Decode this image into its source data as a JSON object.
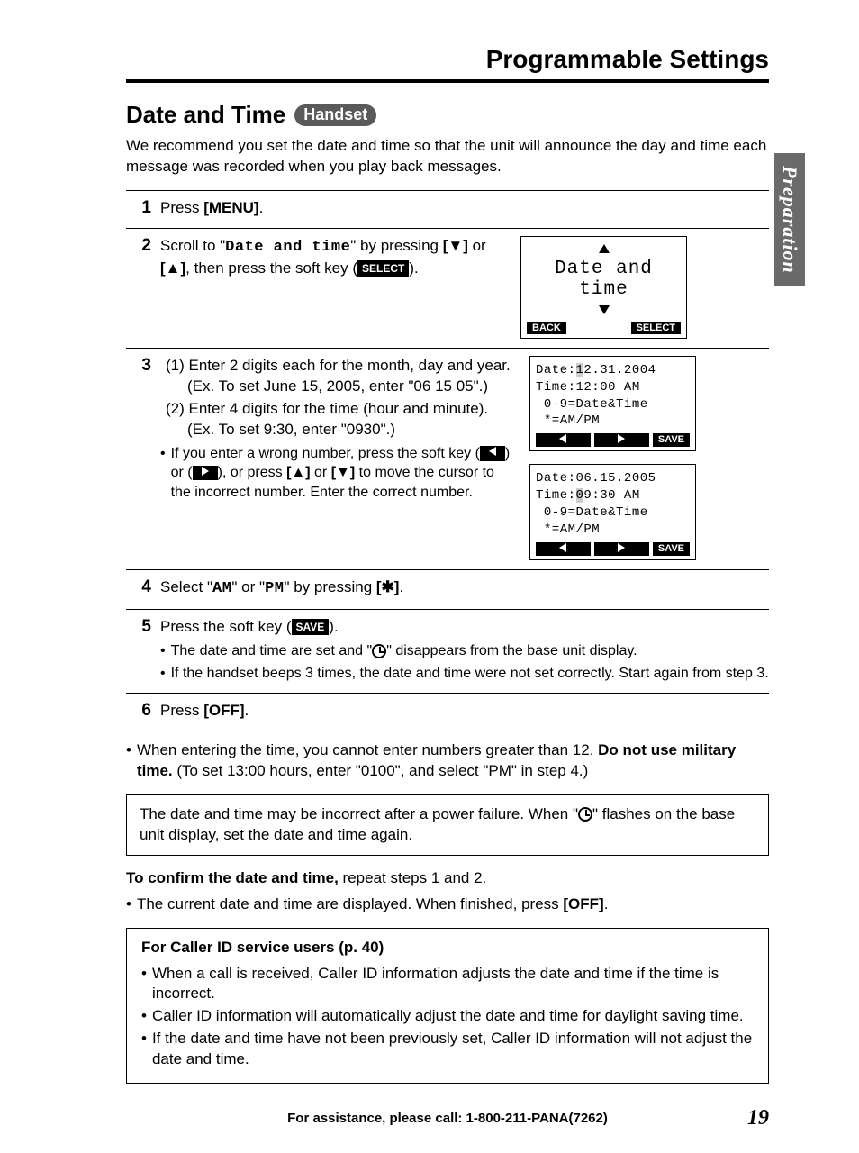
{
  "header": {
    "title": "Programmable Settings"
  },
  "sideTab": "Preparation",
  "section": {
    "title": "Date and Time",
    "badge": "Handset",
    "intro": "We recommend you set the date and time so that the unit will announce the day and time each message was recorded when you play back messages."
  },
  "steps": {
    "s1": {
      "num": "1",
      "text_a": "Press ",
      "text_b": "[MENU]",
      "text_c": "."
    },
    "s2": {
      "num": "2",
      "t1": "Scroll to \"",
      "mono": "Date and time",
      "t2": "\" by pressing ",
      "k1": "[▼]",
      "t3": " or ",
      "k2": "[▲]",
      "t4": ", then press the soft key (",
      "badge": "SELECT",
      "t5": ").",
      "screen": {
        "title": "Date and time",
        "back": "BACK",
        "select": "SELECT"
      }
    },
    "s3": {
      "num": "3",
      "p1a": "(1) Enter 2 digits each for the month, day and year. (Ex. To set June 15, 2005, enter \"06 15 05\".)",
      "p2a": "(2) Enter 4 digits for the time (hour and minute). (Ex. To set 9:30, enter \"0930\".)",
      "bullet_a": "If you enter a wrong number, press the soft key (",
      "bullet_b": ") or (",
      "bullet_c": "), or press ",
      "k1": "[▲]",
      "bullet_d": " or ",
      "k2": "[▼]",
      "bullet_e": " to move the cursor to the incorrect number. Enter the correct number.",
      "screenA": {
        "l1": "Date:12.31.2004",
        "l2": "Time:12:00 AM",
        "l3": " 0-9=Date&Time",
        "l4": " *=AM/PM",
        "save": "SAVE"
      },
      "screenB": {
        "l1": "Date:06.15.2005",
        "l2": "Time:09:30 AM",
        "l3": " 0-9=Date&Time",
        "l4": " *=AM/PM",
        "save": "SAVE"
      }
    },
    "s4": {
      "num": "4",
      "t1": "Select \"",
      "m1": "AM",
      "t2": "\" or \"",
      "m2": "PM",
      "t3": "\" by pressing ",
      "k1": "[✱]",
      "t4": "."
    },
    "s5": {
      "num": "5",
      "t1": "Press the soft key (",
      "badge": "SAVE",
      "t2": ").",
      "b1a": "The date and time are set and \"",
      "b1b": "\" disappears from the base unit display.",
      "b2": "If the handset beeps 3 times, the date and time were not set correctly. Start again from step 3."
    },
    "s6": {
      "num": "6",
      "t1": "Press ",
      "k1": "[OFF]",
      "t2": "."
    }
  },
  "notes": {
    "n1a": "When entering the time, you cannot enter numbers greater than 12. ",
    "n1b": "Do not use military time.",
    "n1c": " (To set 13:00 hours, enter \"0100\", and select \"PM\" in step 4.)",
    "box_a": "The date and time may be incorrect after a power failure. When \"",
    "box_b": "\" flashes on the base unit display, set the date and time again.",
    "confirm_a": "To confirm the date and time,",
    "confirm_b": " repeat steps 1 and 2.",
    "confirm_bullet_a": "The current date and time are displayed. When finished, press ",
    "confirm_bullet_b": "[OFF]",
    "confirm_bullet_c": "."
  },
  "caller": {
    "title": "For Caller ID service users (p. 40)",
    "b1": "When a call is received, Caller ID information adjusts the date and time if the time is incorrect.",
    "b2": "Caller ID information will automatically adjust the date and time for daylight saving time.",
    "b3": "If the date and time have not been previously set, Caller ID information will not adjust the date and time."
  },
  "footer": {
    "assist": "For assistance, please call: 1-800-211-PANA(7262)",
    "page": "19"
  }
}
